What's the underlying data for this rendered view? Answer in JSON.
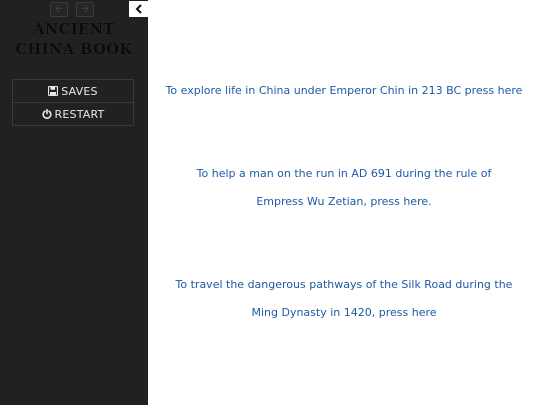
{
  "sidebar": {
    "back_icon": "arrow-left-icon",
    "forward_icon": "arrow-right-icon",
    "collapse_icon": "chevron-left-icon",
    "title_line1": "ANCIENT",
    "title_line2": "CHINA BOOK",
    "menu": [
      {
        "label": "SAVES",
        "icon": "save-icon"
      },
      {
        "label": "RESTART",
        "icon": "power-icon"
      }
    ]
  },
  "main": {
    "choices": [
      {
        "text": "To explore life in China under Emperor Chin in 213 BC press here"
      },
      {
        "text": "To help a man on the run in AD 691 during the rule of Empress Wu Zetian, press here."
      },
      {
        "text": "To travel the dangerous pathways of the Silk Road during the Ming Dynasty in 1420, press here"
      }
    ]
  },
  "colors": {
    "sidebar_bg": "#212121",
    "link": "#1e5aa6",
    "page_bg": "#ffffff"
  }
}
